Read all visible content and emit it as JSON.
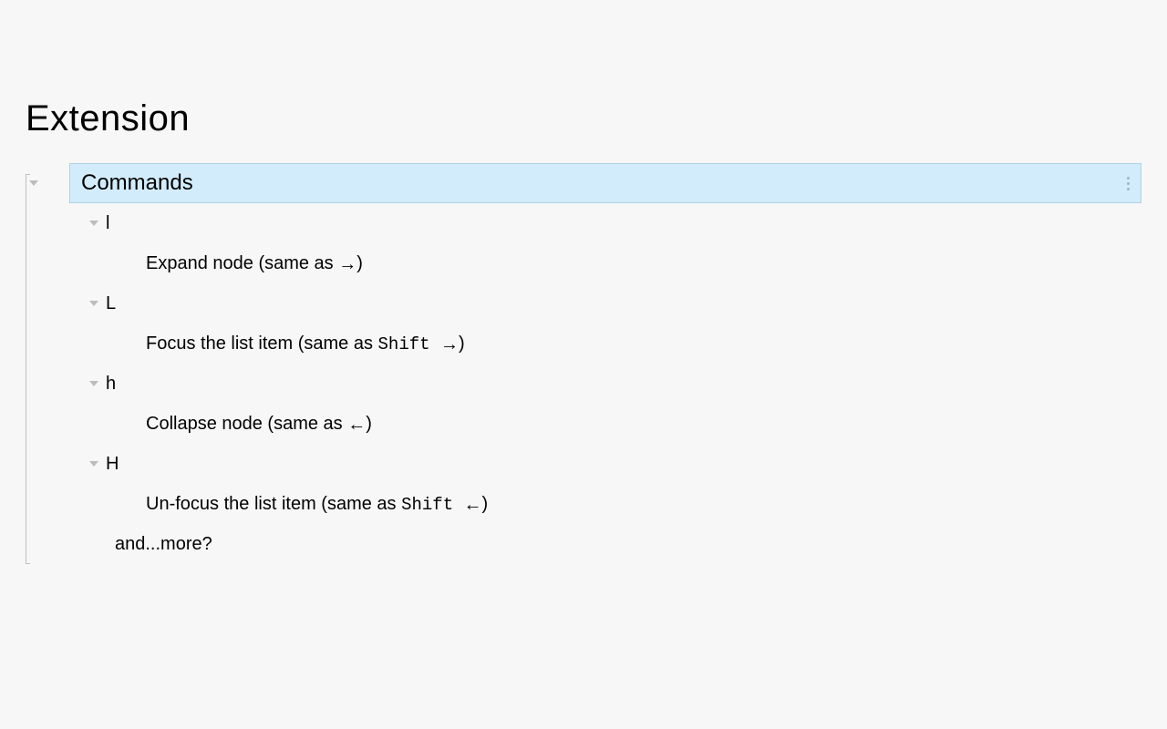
{
  "page": {
    "title": "Extension"
  },
  "sectionHeader": {
    "label": "Commands"
  },
  "commands": [
    {
      "key": "l",
      "desc_prefix": "Expand node (same as ",
      "desc_kbd": "",
      "arrow": "→",
      "desc_suffix": ")"
    },
    {
      "key": "L",
      "desc_prefix": "Focus the list item (same as ",
      "desc_kbd": "Shift ",
      "arrow": "→",
      "desc_suffix": ")"
    },
    {
      "key": "h",
      "desc_prefix": "Collapse node (same as ",
      "desc_kbd": "",
      "arrow": "←",
      "desc_suffix": ")"
    },
    {
      "key": "H",
      "desc_prefix": "Un-focus the list item (same as ",
      "desc_kbd": "Shift ",
      "arrow": "←",
      "desc_suffix": ")"
    }
  ],
  "footer": {
    "label": "and...more?"
  }
}
